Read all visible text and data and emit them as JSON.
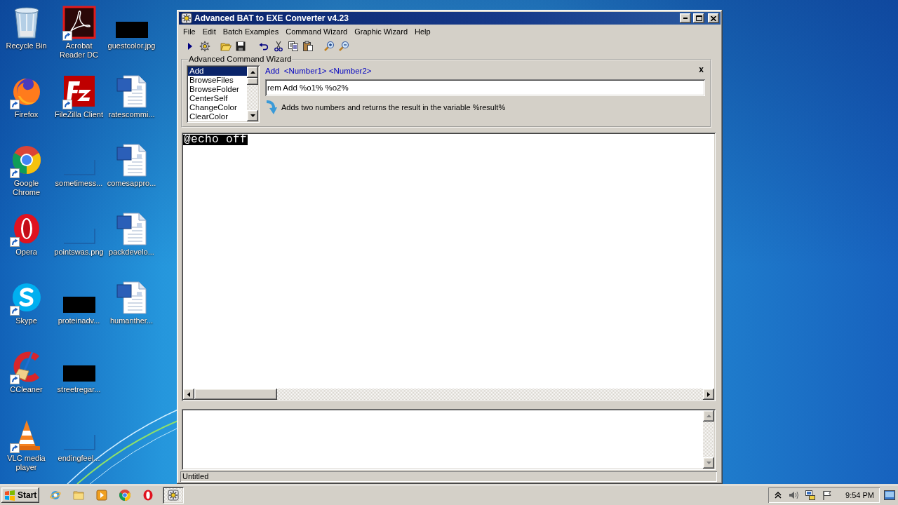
{
  "desktop": {
    "icons": [
      {
        "label": "Recycle Bin",
        "kind": "recycle-bin",
        "shortcut": false
      },
      {
        "label": "Firefox",
        "kind": "firefox",
        "shortcut": true
      },
      {
        "label": "Google Chrome",
        "kind": "chrome",
        "shortcut": true
      },
      {
        "label": "Opera",
        "kind": "opera",
        "shortcut": true
      },
      {
        "label": "Skype",
        "kind": "skype",
        "shortcut": true
      },
      {
        "label": "CCleaner",
        "kind": "ccleaner",
        "shortcut": true
      },
      {
        "label": "VLC media player",
        "kind": "vlc",
        "shortcut": true
      },
      {
        "label": "Acrobat Reader DC",
        "kind": "acrobat",
        "shortcut": true
      },
      {
        "label": "FileZilla Client",
        "kind": "filezilla",
        "shortcut": true
      },
      {
        "label": "sometimess...",
        "kind": "blank-image",
        "shortcut": false
      },
      {
        "label": "pointswas.png",
        "kind": "blank-image",
        "shortcut": false
      },
      {
        "label": "proteinadv...",
        "kind": "dark-image",
        "shortcut": false
      },
      {
        "label": "streetregar...",
        "kind": "dark-image",
        "shortcut": false
      },
      {
        "label": "endingfeel...",
        "kind": "blank-image",
        "shortcut": false
      },
      {
        "label": "guestcolor.jpg",
        "kind": "dark-image",
        "shortcut": false
      },
      {
        "label": "ratescommi...",
        "kind": "word",
        "shortcut": false
      },
      {
        "label": "comesappro...",
        "kind": "word",
        "shortcut": false
      },
      {
        "label": "packdevelo...",
        "kind": "word",
        "shortcut": false
      },
      {
        "label": "humanther...",
        "kind": "word",
        "shortcut": false
      }
    ]
  },
  "window": {
    "title": "Advanced BAT to EXE Converter v4.23",
    "menu": [
      "File",
      "Edit",
      "Batch Examples",
      "Command Wizard",
      "Graphic Wizard",
      "Help"
    ]
  },
  "wizard": {
    "title": "Advanced Command Wizard",
    "close": "x",
    "commands": [
      {
        "label": "Add",
        "selected": true
      },
      {
        "label": "BrowseFiles",
        "selected": false
      },
      {
        "label": "BrowseFolder",
        "selected": false
      },
      {
        "label": "CenterSelf",
        "selected": false
      },
      {
        "label": "ChangeColor",
        "selected": false
      },
      {
        "label": "ClearColor",
        "selected": false
      }
    ],
    "syntax": "Add  <Number1> <Number2>",
    "command": "rem Add %o1% %o2%",
    "description": "Adds two numbers and returns the result in the variable %result%"
  },
  "editor": {
    "lines": [
      {
        "text": "@echo off",
        "selected": true
      }
    ]
  },
  "status_bar": "Untitled",
  "taskbar": {
    "start": "Start",
    "tasks": [
      {
        "selected": true
      }
    ],
    "clock": "9:54 PM"
  }
}
